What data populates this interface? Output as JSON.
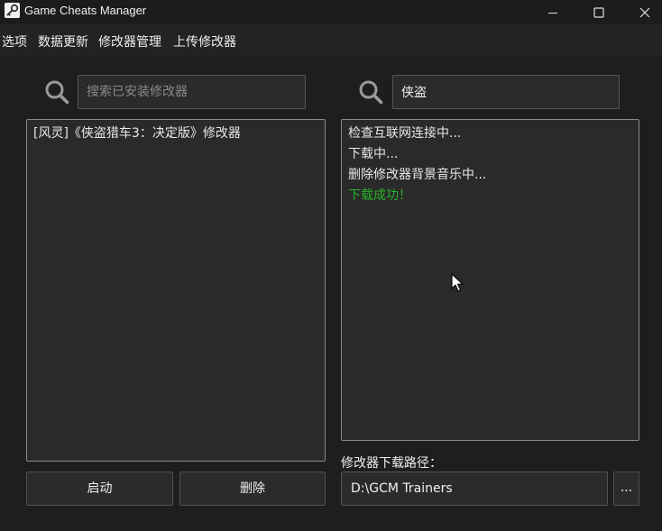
{
  "window": {
    "title": "Game Cheats Manager"
  },
  "menu": {
    "items": [
      "选项",
      "数据更新",
      "修改器管理",
      "上传修改器"
    ]
  },
  "left": {
    "search_placeholder": "搜索已安装修改器",
    "search_value": "",
    "trainers": [
      "[风灵]《侠盗猎车3：决定版》修改器"
    ],
    "launch_label": "启动",
    "delete_label": "删除"
  },
  "right": {
    "search_value": "侠盗",
    "log": [
      {
        "text": "检查互联网连接中...",
        "color": "#e8e8e8"
      },
      {
        "text": "下载中...",
        "color": "#e8e8e8"
      },
      {
        "text": "删除修改器背景音乐中...",
        "color": "#e8e8e8"
      },
      {
        "text": "下载成功！",
        "color": "#27b327"
      }
    ],
    "path_label": "修改器下载路径：",
    "path_value": "D:\\GCM Trainers",
    "browse_label": "..."
  },
  "icons": {
    "app": "key-icon",
    "minimize": "minimize-icon",
    "maximize": "maximize-icon",
    "close": "close-icon",
    "search": "search-icon",
    "cursor": "mouse-pointer-icon"
  }
}
